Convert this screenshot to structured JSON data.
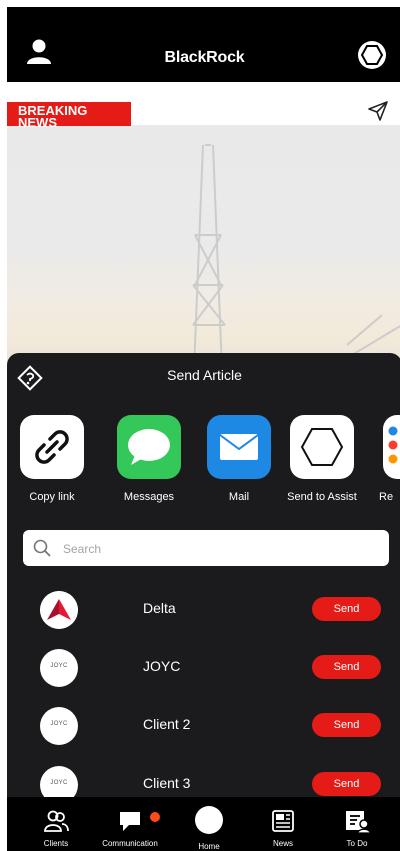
{
  "header": {
    "logo_text": "BlackRock"
  },
  "hero": {
    "badge_line1": "BREAKING",
    "badge_line2": "NEWS"
  },
  "sheet": {
    "title": "Send Article",
    "apps": [
      {
        "label": "Copy link",
        "icon": "link-icon"
      },
      {
        "label": "Messages",
        "icon": "messages-icon"
      },
      {
        "label": "Mail",
        "icon": "mail-icon"
      },
      {
        "label": "Send to Assist",
        "icon": "hexagon-icon"
      },
      {
        "label": "Re",
        "icon": "reminders-icon"
      }
    ],
    "search_placeholder": "Search",
    "contacts": [
      {
        "name": "Delta",
        "avatar": "delta-logo",
        "send_label": "Send"
      },
      {
        "name": "JOYC",
        "avatar": "JOYC",
        "send_label": "Send"
      },
      {
        "name": "Client 2",
        "avatar": "JOYC",
        "send_label": "Send"
      },
      {
        "name": "Client 3",
        "avatar": "JOYC",
        "send_label": "Send"
      }
    ]
  },
  "tabs": [
    {
      "label": "Clients",
      "icon": "clients-icon"
    },
    {
      "label": "Communication",
      "icon": "chat-icon"
    },
    {
      "label": "Home",
      "icon": "home-icon"
    },
    {
      "label": "News",
      "icon": "news-icon"
    },
    {
      "label": "To Do",
      "icon": "todo-icon"
    }
  ],
  "colors": {
    "accent": "#e41b17",
    "sheet_bg": "#1b1b1d",
    "bar_bg": "#000000",
    "messages_green": "#34c759",
    "mail_blue": "#1e88e5",
    "notif_orange": "#ff4a1c"
  }
}
